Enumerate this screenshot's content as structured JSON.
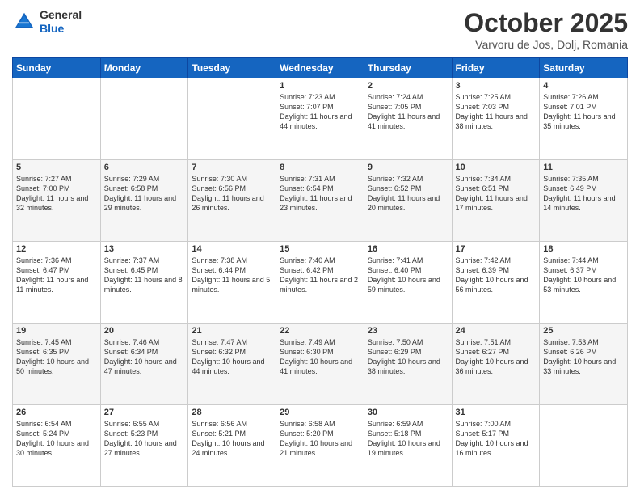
{
  "header": {
    "logo_general": "General",
    "logo_blue": "Blue",
    "month_title": "October 2025",
    "subtitle": "Varvoru de Jos, Dolj, Romania"
  },
  "days_of_week": [
    "Sunday",
    "Monday",
    "Tuesday",
    "Wednesday",
    "Thursday",
    "Friday",
    "Saturday"
  ],
  "weeks": [
    [
      {
        "day": null,
        "text": ""
      },
      {
        "day": null,
        "text": ""
      },
      {
        "day": null,
        "text": ""
      },
      {
        "day": "1",
        "text": "Sunrise: 7:23 AM\nSunset: 7:07 PM\nDaylight: 11 hours and 44 minutes."
      },
      {
        "day": "2",
        "text": "Sunrise: 7:24 AM\nSunset: 7:05 PM\nDaylight: 11 hours and 41 minutes."
      },
      {
        "day": "3",
        "text": "Sunrise: 7:25 AM\nSunset: 7:03 PM\nDaylight: 11 hours and 38 minutes."
      },
      {
        "day": "4",
        "text": "Sunrise: 7:26 AM\nSunset: 7:01 PM\nDaylight: 11 hours and 35 minutes."
      }
    ],
    [
      {
        "day": "5",
        "text": "Sunrise: 7:27 AM\nSunset: 7:00 PM\nDaylight: 11 hours and 32 minutes."
      },
      {
        "day": "6",
        "text": "Sunrise: 7:29 AM\nSunset: 6:58 PM\nDaylight: 11 hours and 29 minutes."
      },
      {
        "day": "7",
        "text": "Sunrise: 7:30 AM\nSunset: 6:56 PM\nDaylight: 11 hours and 26 minutes."
      },
      {
        "day": "8",
        "text": "Sunrise: 7:31 AM\nSunset: 6:54 PM\nDaylight: 11 hours and 23 minutes."
      },
      {
        "day": "9",
        "text": "Sunrise: 7:32 AM\nSunset: 6:52 PM\nDaylight: 11 hours and 20 minutes."
      },
      {
        "day": "10",
        "text": "Sunrise: 7:34 AM\nSunset: 6:51 PM\nDaylight: 11 hours and 17 minutes."
      },
      {
        "day": "11",
        "text": "Sunrise: 7:35 AM\nSunset: 6:49 PM\nDaylight: 11 hours and 14 minutes."
      }
    ],
    [
      {
        "day": "12",
        "text": "Sunrise: 7:36 AM\nSunset: 6:47 PM\nDaylight: 11 hours and 11 minutes."
      },
      {
        "day": "13",
        "text": "Sunrise: 7:37 AM\nSunset: 6:45 PM\nDaylight: 11 hours and 8 minutes."
      },
      {
        "day": "14",
        "text": "Sunrise: 7:38 AM\nSunset: 6:44 PM\nDaylight: 11 hours and 5 minutes."
      },
      {
        "day": "15",
        "text": "Sunrise: 7:40 AM\nSunset: 6:42 PM\nDaylight: 11 hours and 2 minutes."
      },
      {
        "day": "16",
        "text": "Sunrise: 7:41 AM\nSunset: 6:40 PM\nDaylight: 10 hours and 59 minutes."
      },
      {
        "day": "17",
        "text": "Sunrise: 7:42 AM\nSunset: 6:39 PM\nDaylight: 10 hours and 56 minutes."
      },
      {
        "day": "18",
        "text": "Sunrise: 7:44 AM\nSunset: 6:37 PM\nDaylight: 10 hours and 53 minutes."
      }
    ],
    [
      {
        "day": "19",
        "text": "Sunrise: 7:45 AM\nSunset: 6:35 PM\nDaylight: 10 hours and 50 minutes."
      },
      {
        "day": "20",
        "text": "Sunrise: 7:46 AM\nSunset: 6:34 PM\nDaylight: 10 hours and 47 minutes."
      },
      {
        "day": "21",
        "text": "Sunrise: 7:47 AM\nSunset: 6:32 PM\nDaylight: 10 hours and 44 minutes."
      },
      {
        "day": "22",
        "text": "Sunrise: 7:49 AM\nSunset: 6:30 PM\nDaylight: 10 hours and 41 minutes."
      },
      {
        "day": "23",
        "text": "Sunrise: 7:50 AM\nSunset: 6:29 PM\nDaylight: 10 hours and 38 minutes."
      },
      {
        "day": "24",
        "text": "Sunrise: 7:51 AM\nSunset: 6:27 PM\nDaylight: 10 hours and 36 minutes."
      },
      {
        "day": "25",
        "text": "Sunrise: 7:53 AM\nSunset: 6:26 PM\nDaylight: 10 hours and 33 minutes."
      }
    ],
    [
      {
        "day": "26",
        "text": "Sunrise: 6:54 AM\nSunset: 5:24 PM\nDaylight: 10 hours and 30 minutes."
      },
      {
        "day": "27",
        "text": "Sunrise: 6:55 AM\nSunset: 5:23 PM\nDaylight: 10 hours and 27 minutes."
      },
      {
        "day": "28",
        "text": "Sunrise: 6:56 AM\nSunset: 5:21 PM\nDaylight: 10 hours and 24 minutes."
      },
      {
        "day": "29",
        "text": "Sunrise: 6:58 AM\nSunset: 5:20 PM\nDaylight: 10 hours and 21 minutes."
      },
      {
        "day": "30",
        "text": "Sunrise: 6:59 AM\nSunset: 5:18 PM\nDaylight: 10 hours and 19 minutes."
      },
      {
        "day": "31",
        "text": "Sunrise: 7:00 AM\nSunset: 5:17 PM\nDaylight: 10 hours and 16 minutes."
      },
      {
        "day": null,
        "text": ""
      }
    ]
  ]
}
